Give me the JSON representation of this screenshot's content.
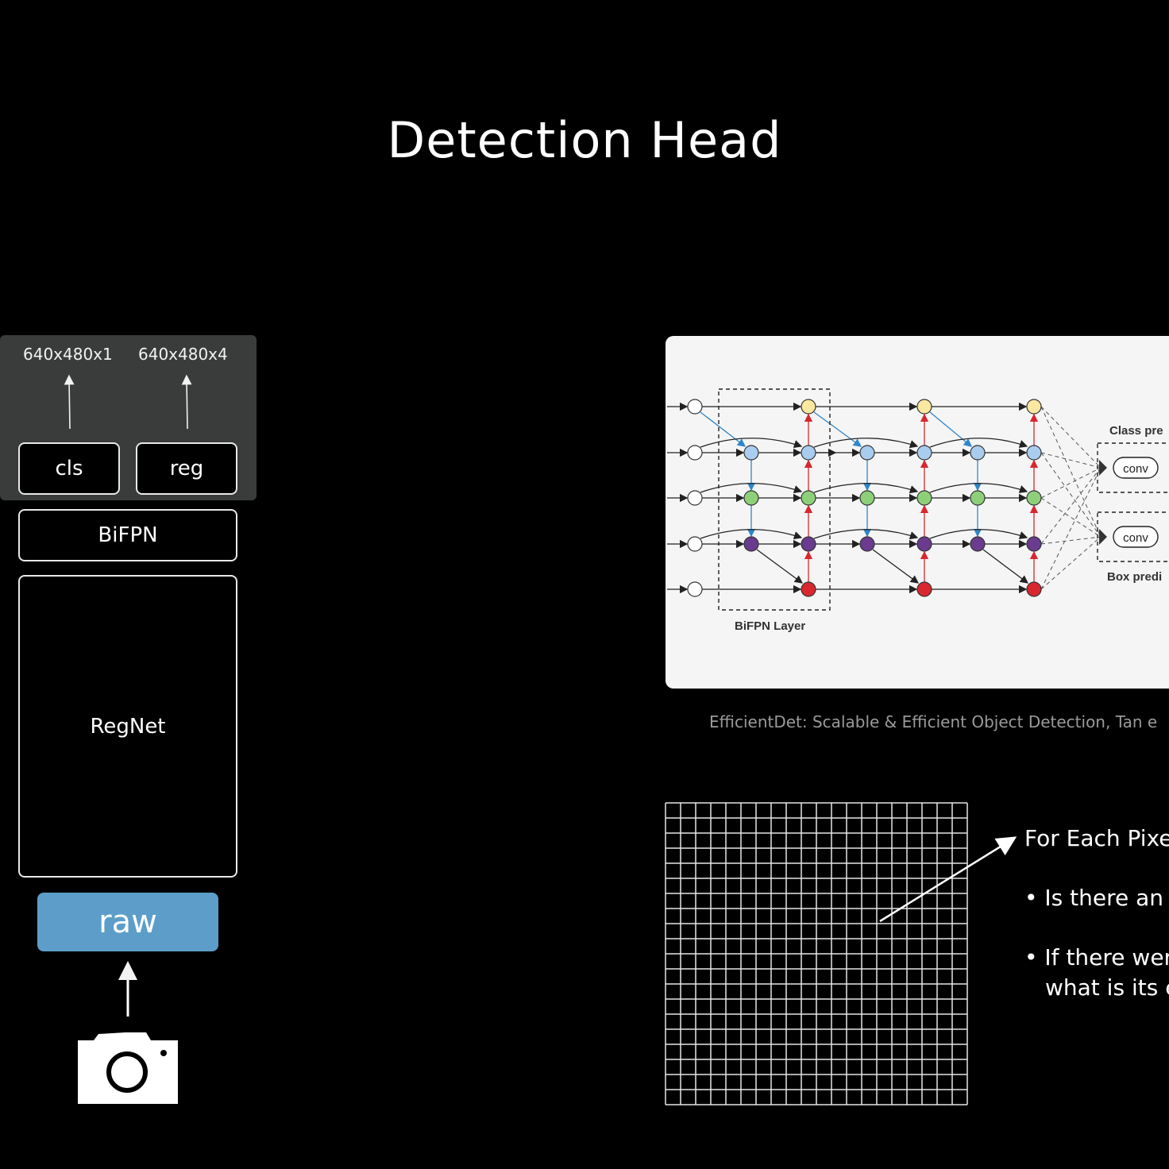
{
  "slide": {
    "title": "Detection Head"
  },
  "pipeline": {
    "outputs": [
      {
        "shape": "640x480x1",
        "head": "cls"
      },
      {
        "shape": "640x480x4",
        "head": "reg"
      }
    ],
    "neck": "BiFPN",
    "backbone": "RegNet",
    "input": "raw",
    "sensor_icon": "camera-icon"
  },
  "figure": {
    "layer_label": "BiFPN Layer",
    "class_label": "Class pre",
    "box_label": "Box predi",
    "conv_label": "conv",
    "caption": "EfficientDet: Scalable & Efficient Object Detection, Tan e",
    "node_colors": {
      "input": "#ffffff",
      "top": "#fbe8a0",
      "blue": "#a9cdef",
      "green": "#8ed07a",
      "purple": "#6a3b8e",
      "red": "#d8272f"
    }
  },
  "pixel_grid": {
    "heading": "For Each Pixe",
    "bullets": [
      "Is there an c",
      "If there wer"
    ],
    "bullet_continuation": "what is its e"
  }
}
